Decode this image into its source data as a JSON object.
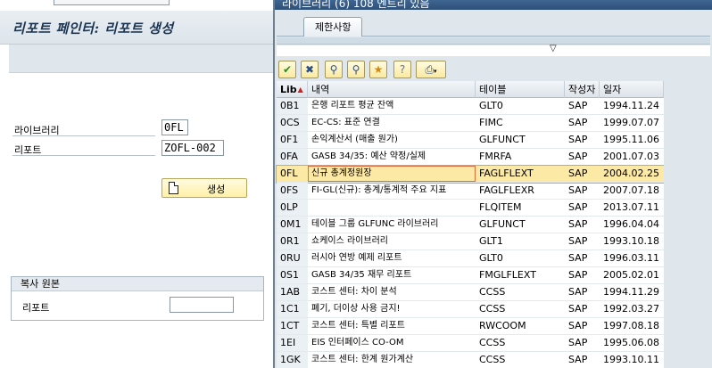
{
  "main": {
    "page_title": "리포트 페인터: 리포트 생성",
    "library_label": "라이브러리",
    "library_value": "0FL",
    "report_label": "리포트",
    "report_value": "ZOFL-002",
    "create_button_label": "생성",
    "copy_from_group": {
      "title": "복사 원본",
      "report_label": "리포트",
      "report_value": ""
    }
  },
  "dialog": {
    "title": "라이브러리 (6)  108 엔트리 있음",
    "tab_label": "제한사항",
    "toolbar": [
      {
        "name": "check-icon",
        "glyph": "✔",
        "color": "#2a8a2a"
      },
      {
        "name": "cancel-icon",
        "glyph": "✖",
        "color": "#2b4f8a"
      },
      {
        "name": "binoculars-icon",
        "glyph": "⚲",
        "color": "#2b4f8a"
      },
      {
        "name": "find-next-icon",
        "glyph": "⚲",
        "color": "#2b4f8a"
      },
      {
        "name": "favorite-icon",
        "glyph": "★",
        "color": "#d28a10"
      },
      {
        "name": "help-icon",
        "glyph": "?",
        "color": "#6a7380"
      },
      {
        "name": "print-icon",
        "glyph": "⎙",
        "color": "#2b4f8a"
      }
    ],
    "columns": {
      "lib": "Lib",
      "description": "내역",
      "table": "테이블",
      "author": "작성자",
      "date": "일자"
    },
    "rows": [
      {
        "lib": "0B1",
        "desc": "은행 리포트 평균 잔액",
        "table": "GLT0",
        "author": "SAP",
        "date": "1994.11.24"
      },
      {
        "lib": "0CS",
        "desc": "EC-CS: 표준 연결",
        "table": "FIMC",
        "author": "SAP",
        "date": "1999.07.07"
      },
      {
        "lib": "0F1",
        "desc": "손익계산서 (매출 원가)",
        "table": "GLFUNCT",
        "author": "SAP",
        "date": "1995.11.06"
      },
      {
        "lib": "0FA",
        "desc": "GASB 34/35: 예산 약정/실제",
        "table": "FMRFA",
        "author": "SAP",
        "date": "2001.07.03"
      },
      {
        "lib": "0FL",
        "desc": "신규 총계정원장",
        "table": "FAGLFLEXT",
        "author": "SAP",
        "date": "2004.02.25"
      },
      {
        "lib": "0FS",
        "desc": "FI-GL(신규): 총계/통계적 주요 지표",
        "table": "FAGLFLEXR",
        "author": "SAP",
        "date": "2007.07.18"
      },
      {
        "lib": "0LP",
        "desc": "",
        "table": "FLQITEM",
        "author": "SAP",
        "date": "2013.07.11"
      },
      {
        "lib": "0M1",
        "desc": "테이블 그룹 GLFUNC 라이브러리",
        "table": "GLFUNCT",
        "author": "SAP",
        "date": "1996.04.04"
      },
      {
        "lib": "0R1",
        "desc": "쇼케이스 라이브러리",
        "table": "GLT1",
        "author": "SAP",
        "date": "1993.10.18"
      },
      {
        "lib": "0RU",
        "desc": "러시아 연방 예제 리포트",
        "table": "GLT0",
        "author": "SAP",
        "date": "1996.03.11"
      },
      {
        "lib": "0S1",
        "desc": "GASB 34/35 재무 리포트",
        "table": "FMGLFLEXT",
        "author": "SAP",
        "date": "2005.02.01"
      },
      {
        "lib": "1AB",
        "desc": "코스트 센터: 차이 분석",
        "table": "CCSS",
        "author": "SAP",
        "date": "1994.11.29"
      },
      {
        "lib": "1C1",
        "desc": "폐기, 더이상 사용 금지!",
        "table": "CCSS",
        "author": "SAP",
        "date": "1992.03.27"
      },
      {
        "lib": "1CT",
        "desc": "코스트 센터: 특별 리포트",
        "table": "RWCOOM",
        "author": "SAP",
        "date": "1997.08.18"
      },
      {
        "lib": "1EI",
        "desc": "EIS 인터페이스 CO-OM",
        "table": "CCSS",
        "author": "SAP",
        "date": "1995.06.08"
      },
      {
        "lib": "1GK",
        "desc": "코스트 센터: 한계 원가계산",
        "table": "CCSS",
        "author": "SAP",
        "date": "1993.10.11"
      }
    ],
    "selected_index": 4
  }
}
